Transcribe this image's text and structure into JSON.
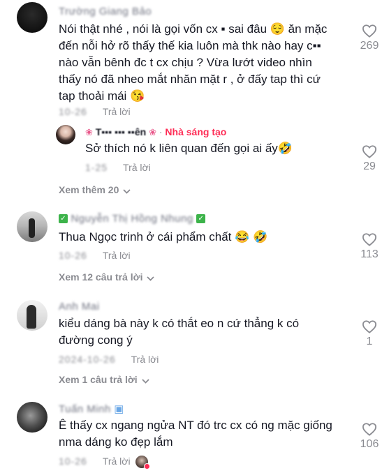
{
  "comments": [
    {
      "username": "Trường Giang Bảo",
      "text_lines": [
        "Nói thật nhé , nói là gọi vốn cx ▪ sai đâu 😌 ăn mặc",
        "đến nỗi hở rõ thấy thế kia luôn mà thk nào hay c▪▪",
        "nào vẫn bênh đc t cx chịu ? Vừa lướt video nhìn",
        "thấy nó đã nheo mắt nhăn mặt r , ở đấy tap thì cứ",
        "tap thoải mái 😘"
      ],
      "date": "10-26",
      "reply_label": "Trả lời",
      "likes": "269",
      "view_more": "Xem thêm 20",
      "reply": {
        "username": "T▪▪▪ ▪▪▪ ▪▪ên",
        "creator_label": "Nhà sáng tạo",
        "text": "Sở thích nó k liên quan đến gọi ai ấy🤣",
        "date": "1-25",
        "reply_label": "Trả lời",
        "likes": "29"
      }
    },
    {
      "username": "Nguyễn Thị Hồng Nhung",
      "text_lines": [
        "Thua Ngọc trinh ở cái phẩm chất 😂 🤣"
      ],
      "date": "10-26",
      "reply_label": "Trả lời",
      "likes": "113",
      "view_more": "Xem 12 câu trả lời"
    },
    {
      "username": "Anh Mai",
      "text_lines": [
        "kiểu dáng bà này k có thắt eo n cứ thẳng k có",
        "đường cong ý"
      ],
      "date": "2024-10-26",
      "reply_label": "Trả lời",
      "likes": "1",
      "view_more": "Xem 1 câu trả lời"
    },
    {
      "username": "Tuấn Minh",
      "text_lines": [
        "Ê thấy cx ngang ngửa NT đó trc cx có ng mặc giống",
        "nma dáng ko đẹp lắm"
      ],
      "date": "10-26",
      "reply_label": "Trả lời",
      "likes": "106"
    }
  ]
}
